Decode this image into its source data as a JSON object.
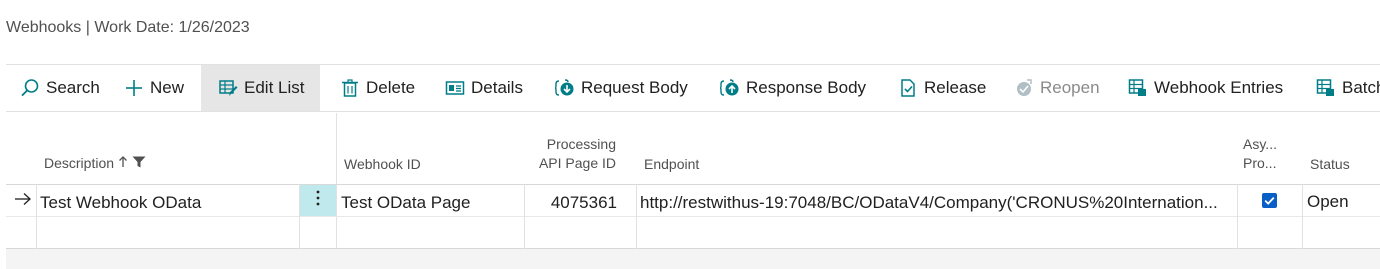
{
  "page": {
    "title": "Webhooks | Work Date: 1/26/2023"
  },
  "toolbar": {
    "search": "Search",
    "new": "New",
    "edit_list": "Edit List",
    "delete": "Delete",
    "details": "Details",
    "request_body": "Request Body",
    "response_body": "Response Body",
    "release": "Release",
    "reopen": "Reopen",
    "webhook_entries": "Webhook Entries",
    "batch": "Batch"
  },
  "columns": {
    "description": "Description",
    "webhook_id": "Webhook ID",
    "processing_line1": "Processing",
    "processing_line2": "API Page ID",
    "endpoint": "Endpoint",
    "async_line1": "Asy...",
    "async_line2": "Pro...",
    "status": "Status"
  },
  "rows": [
    {
      "description": "Test Webhook OData",
      "webhook_id": "Test OData Page",
      "processing_api_page_id": "4075361",
      "endpoint": "http://restwithus-19:7048/BC/ODataV4/Company('CRONUS%20Internation...",
      "async_processing": true,
      "status": "Open"
    }
  ],
  "colors": {
    "accent": "#007d87",
    "selected_cell": "#bfe9ec",
    "row_arrow": "#212121"
  }
}
